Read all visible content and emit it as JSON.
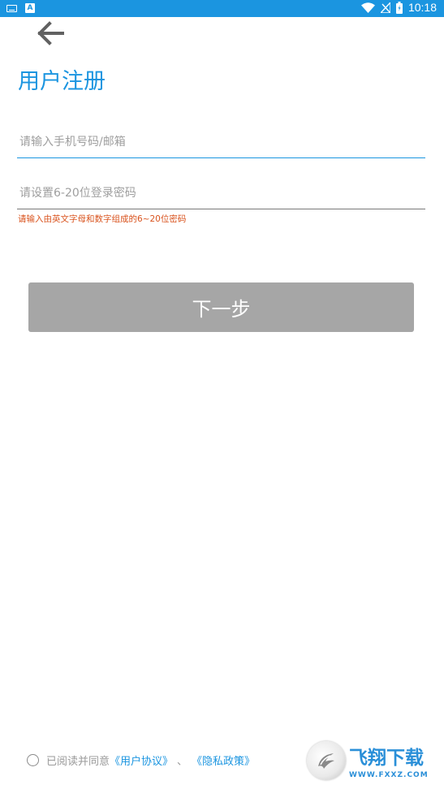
{
  "status_bar": {
    "time": "10:18",
    "left_icons": [
      "keyboard-icon",
      "a-app-icon"
    ],
    "right_icons": [
      "wifi-icon",
      "signal-icon",
      "battery-icon"
    ],
    "a_icon_letter": "A"
  },
  "header": {
    "back_icon": "arrow-left-icon",
    "title": "用户注册"
  },
  "form": {
    "phone_placeholder": "请输入手机号码/邮箱",
    "phone_value": "",
    "password_placeholder": "请设置6-20位登录密码",
    "password_value": "",
    "password_hint": "请输入由英文字母和数字组成的6~20位密码",
    "next_label": "下一步"
  },
  "agreement": {
    "checked": false,
    "prefix": "已阅读并同意",
    "user_agreement": "《用户协议》",
    "separator": "、",
    "privacy_policy": "《隐私政策》"
  },
  "watermark": {
    "name_cn": "飞翔下载",
    "domain": "WWW.FXXZ.COM"
  },
  "colors": {
    "accent": "#1b95e0",
    "hint_error": "#d9531e",
    "button_disabled": "#a6a6a6"
  }
}
